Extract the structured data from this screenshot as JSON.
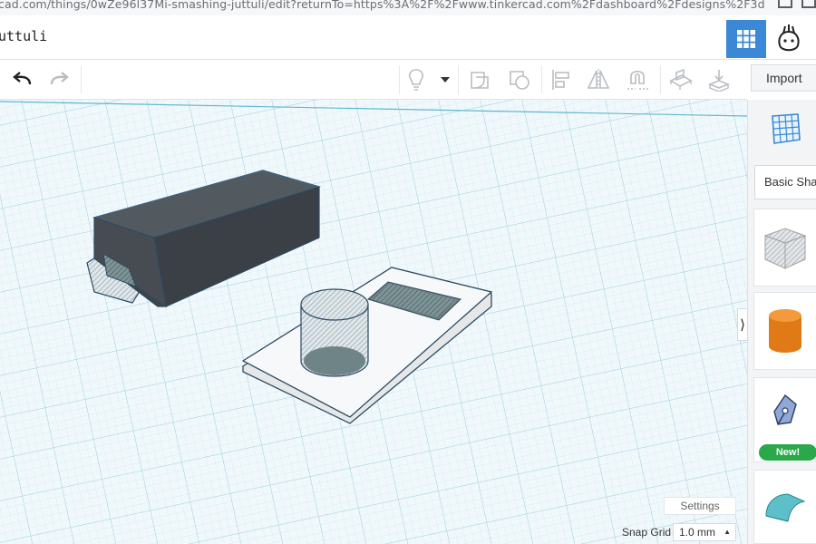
{
  "browser": {
    "url": "cad.com/things/0wZe96l37Mi-smashing-juttuli/edit?returnTo=https%3A%2F%2Fwww.tinkercad.com%2Fdashboard%2Fdesigns%2F3d"
  },
  "header": {
    "title": "uttuli",
    "grid_icon": "grid-view-icon",
    "avatar_icon": "user-avatar-icon"
  },
  "toolbar": {
    "undo_icon": "undo-arrow-icon",
    "redo_icon": "redo-arrow-icon",
    "light_icon": "lightbulb-icon",
    "import_label": "Import"
  },
  "panel": {
    "category_label": "Basic Sha",
    "new_badge": "New!",
    "collapse_glyph": "⟩"
  },
  "footer": {
    "settings_label": "Settings",
    "snap_grid_label": "Snap Grid",
    "snap_grid_value": "1.0 mm",
    "snap_arrow": "▲"
  },
  "colors": {
    "accent": "#3b88d6",
    "box": "#3e4449",
    "cylinder": "#e07a16",
    "new_badge": "#2aa84a",
    "grid_line": "#bfe3ec",
    "workplane": "#f1f8fb"
  }
}
